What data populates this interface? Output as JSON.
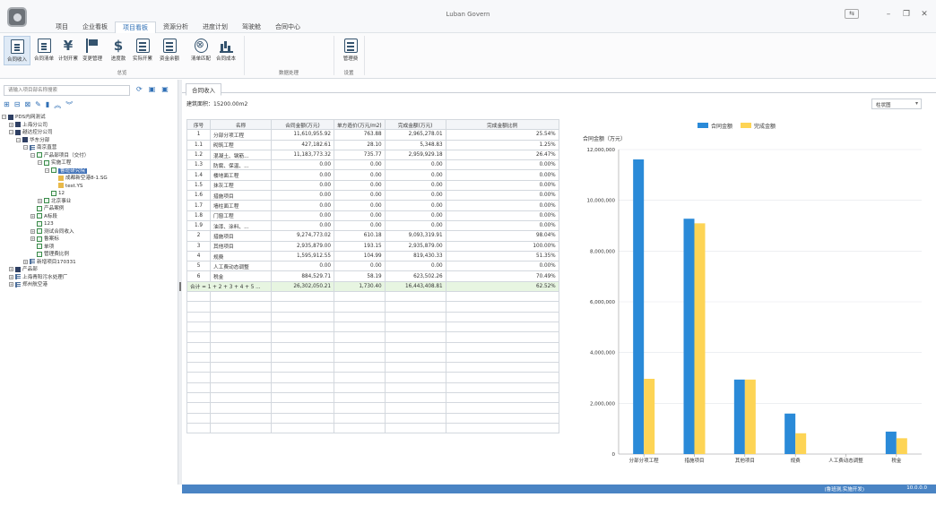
{
  "app": {
    "title": "Luban Govern"
  },
  "menu": [
    "项目",
    "企业看板",
    "项目看板",
    "资源分析",
    "进度计划",
    "驾驶舱",
    "合同中心"
  ],
  "ribbon": {
    "buttons": [
      {
        "label": "合同收入",
        "icon": "contract-income-icon",
        "active": true
      },
      {
        "label": "合同清单",
        "icon": "contract-list-icon"
      },
      {
        "label": "计划开累",
        "icon": "plan-money-icon"
      },
      {
        "label": "变更管理",
        "icon": "change-management-icon"
      },
      {
        "label": "进度款",
        "icon": "progress-payment-icon"
      },
      {
        "label": "实际开累",
        "icon": "actual-accumulated-icon"
      },
      {
        "label": "资金余额",
        "icon": "fund-balance-icon"
      },
      {
        "label": "清单匹配",
        "icon": "list-match-icon"
      },
      {
        "label": "合同成本",
        "icon": "contract-cost-icon"
      },
      {
        "label": "管理费",
        "icon": "management-fee-icon"
      }
    ],
    "groups": [
      "总览",
      "数据处理",
      "设置"
    ]
  },
  "left": {
    "search_placeholder": "请输入项目部名称搜索",
    "tree": [
      {
        "label": "PDS内网测试",
        "level": 0,
        "icon": "org",
        "exp": "−"
      },
      {
        "label": "上海分公司",
        "level": 1,
        "icon": "org",
        "exp": "+"
      },
      {
        "label": "越达控分公司",
        "level": 1,
        "icon": "org",
        "exp": "−"
      },
      {
        "label": "华东分部",
        "level": 2,
        "icon": "org",
        "exp": "−"
      },
      {
        "label": "南京直营",
        "level": 3,
        "icon": "list",
        "exp": "−"
      },
      {
        "label": "产品部项目（交付）",
        "level": 4,
        "icon": "proj",
        "exp": "−"
      },
      {
        "label": "实施工程",
        "level": 5,
        "icon": "proj",
        "exp": "−"
      },
      {
        "label": "鲁班研究院",
        "level": 6,
        "icon": "proj",
        "exp": "−",
        "selected": true
      },
      {
        "label": "成都新空港8-1.SG",
        "level": 7,
        "icon": "folder",
        "exp": ""
      },
      {
        "label": "test.YS",
        "level": 7,
        "icon": "folder",
        "exp": ""
      },
      {
        "label": "12",
        "level": 6,
        "icon": "proj",
        "exp": ""
      },
      {
        "label": "北京事业",
        "level": 5,
        "icon": "proj",
        "exp": "+"
      },
      {
        "label": "产品案例",
        "level": 4,
        "icon": "proj",
        "exp": ""
      },
      {
        "label": "A标段",
        "level": 4,
        "icon": "proj",
        "exp": "+"
      },
      {
        "label": "123",
        "level": 4,
        "icon": "proj",
        "exp": ""
      },
      {
        "label": "测试合同收入",
        "level": 4,
        "icon": "proj",
        "exp": "+"
      },
      {
        "label": "鲁案标",
        "level": 4,
        "icon": "proj",
        "exp": "+"
      },
      {
        "label": "单项",
        "level": 4,
        "icon": "proj",
        "exp": ""
      },
      {
        "label": "管理费比例",
        "level": 4,
        "icon": "proj",
        "exp": ""
      },
      {
        "label": "新增项目170331",
        "level": 3,
        "icon": "list",
        "exp": "+"
      },
      {
        "label": "产品部",
        "level": 1,
        "icon": "org",
        "exp": "+"
      },
      {
        "label": "上海青阳污水处理厂",
        "level": 1,
        "icon": "list",
        "exp": "+"
      },
      {
        "label": "郑州航空港",
        "level": 1,
        "icon": "list",
        "exp": "+"
      }
    ]
  },
  "main": {
    "tab": "合同收入",
    "area": "建筑面积：15200.00m2",
    "chart_type": "柱状图",
    "columns": [
      "序号",
      "名称",
      "合同金额(万元)",
      "单方造价(万元/m2)",
      "完成金额(万元)",
      "完成金额比例"
    ],
    "rows": [
      [
        "1",
        "分部分项工程",
        "11,610,955.92",
        "763.88",
        "2,965,278.01",
        "25.54%"
      ],
      [
        "1.1",
        "砌筑工程",
        "427,182.61",
        "28.10",
        "5,348.83",
        "1.25%"
      ],
      [
        "1.2",
        "混凝土、钢筋...",
        "11,183,773.32",
        "735.77",
        "2,959,929.18",
        "26.47%"
      ],
      [
        "1.3",
        "防腐、保温、...",
        "0.00",
        "0.00",
        "0.00",
        "0.00%"
      ],
      [
        "1.4",
        "楼地面工程",
        "0.00",
        "0.00",
        "0.00",
        "0.00%"
      ],
      [
        "1.5",
        "抹灰工程",
        "0.00",
        "0.00",
        "0.00",
        "0.00%"
      ],
      [
        "1.6",
        "措施项目",
        "0.00",
        "0.00",
        "0.00",
        "0.00%"
      ],
      [
        "1.7",
        "墙柱面工程",
        "0.00",
        "0.00",
        "0.00",
        "0.00%"
      ],
      [
        "1.8",
        "门窗工程",
        "0.00",
        "0.00",
        "0.00",
        "0.00%"
      ],
      [
        "1.9",
        "油漆、涂料、...",
        "0.00",
        "0.00",
        "0.00",
        "0.00%"
      ],
      [
        "2",
        "措施项目",
        "9,274,773.02",
        "610.18",
        "9,093,319.91",
        "98.04%"
      ],
      [
        "3",
        "其他项目",
        "2,935,879.00",
        "193.15",
        "2,935,879.00",
        "100.00%"
      ],
      [
        "4",
        "规费",
        "1,595,912.55",
        "104.99",
        "819,430.33",
        "51.35%"
      ],
      [
        "5",
        "人工费动态调整",
        "0.00",
        "0.00",
        "0.00",
        "0.00%"
      ],
      [
        "6",
        "税金",
        "884,529.71",
        "58.19",
        "623,502.26",
        "70.49%"
      ]
    ],
    "total": [
      "合计 = 1 + 2 + 3 + 4 + 5 ...",
      "26,302,050.21",
      "1,730.40",
      "16,443,408.81",
      "62.52%"
    ]
  },
  "chart_data": {
    "type": "bar",
    "ylabel": "合同金额（万元）",
    "categories": [
      "分部分项工程",
      "措施项目",
      "其他项目",
      "规费",
      "人工费动态调整",
      "税金"
    ],
    "series": [
      {
        "name": "合同金额",
        "color": "#2a8ad8",
        "values": [
          11610955.92,
          9274773.02,
          2935879.0,
          1595912.55,
          0,
          884529.71
        ]
      },
      {
        "name": "完成金额",
        "color": "#fdd455",
        "values": [
          2965278.01,
          9093319.91,
          2935879.0,
          819430.33,
          0,
          623502.26
        ]
      }
    ],
    "ylim": [
      0,
      12000000
    ],
    "yticks": [
      "0",
      "2,000,000",
      "4,000,000",
      "6,000,000",
      "8,000,000",
      "10,000,000",
      "12,000,000"
    ],
    "legend": "top-center",
    "grid": true
  },
  "status": {
    "left": "(鲁班测,实施开发)",
    "right": "10.0.0.0"
  }
}
